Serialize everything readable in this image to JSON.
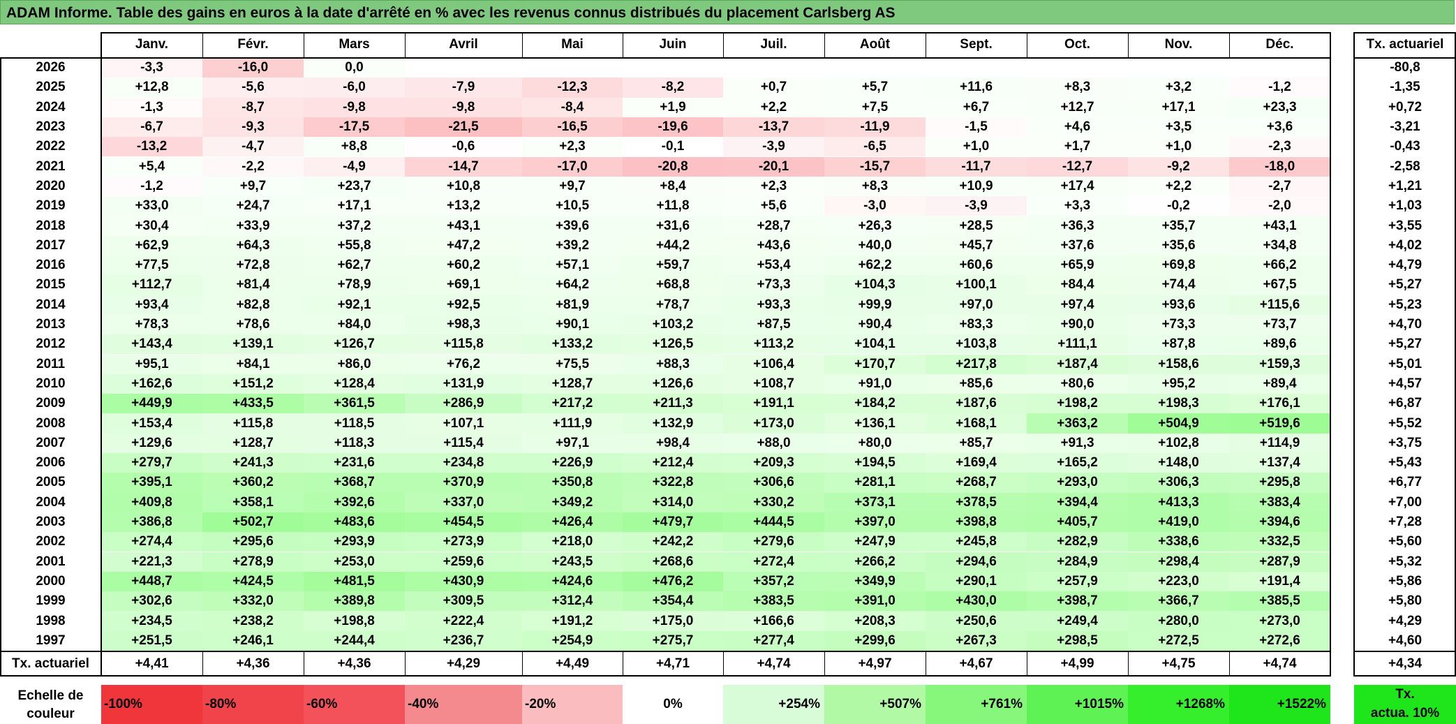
{
  "title": "ADAM Informe. Table des gains en euros à la date d'arrêté en % avec les revenus connus distribués du placement Carlsberg AS",
  "months": [
    "Janv.",
    "Févr.",
    "Mars",
    "Avril",
    "Mai",
    "Juin",
    "Juil.",
    "Août",
    "Sept.",
    "Oct.",
    "Nov.",
    "Déc."
  ],
  "tx_header": "Tx. actuariel",
  "rows": [
    {
      "year": "2026",
      "values": [
        "-3,3",
        "-16,0",
        "0,0",
        "",
        "",
        "",
        "",
        "",
        "",
        "",
        "",
        ""
      ],
      "tx": "-80,8"
    },
    {
      "year": "2025",
      "values": [
        "+12,8",
        "-5,6",
        "-6,0",
        "-7,9",
        "-12,3",
        "-8,2",
        "+0,7",
        "+5,7",
        "+11,6",
        "+8,3",
        "+3,2",
        "-1,2"
      ],
      "tx": "-1,35"
    },
    {
      "year": "2024",
      "values": [
        "-1,3",
        "-8,7",
        "-9,8",
        "-9,8",
        "-8,4",
        "+1,9",
        "+2,2",
        "+7,5",
        "+6,7",
        "+12,7",
        "+17,1",
        "+23,3"
      ],
      "tx": "+0,72"
    },
    {
      "year": "2023",
      "values": [
        "-6,7",
        "-9,3",
        "-17,5",
        "-21,5",
        "-16,5",
        "-19,6",
        "-13,7",
        "-11,9",
        "-1,5",
        "+4,6",
        "+3,5",
        "+3,6"
      ],
      "tx": "-3,21"
    },
    {
      "year": "2022",
      "values": [
        "-13,2",
        "-4,7",
        "+8,8",
        "-0,6",
        "+2,3",
        "-0,1",
        "-3,9",
        "-6,5",
        "+1,0",
        "+1,7",
        "+1,0",
        "-2,3"
      ],
      "tx": "-0,43"
    },
    {
      "year": "2021",
      "values": [
        "+5,4",
        "-2,2",
        "-4,9",
        "-14,7",
        "-17,0",
        "-20,8",
        "-20,1",
        "-15,7",
        "-11,7",
        "-12,7",
        "-9,2",
        "-18,0"
      ],
      "tx": "-2,58"
    },
    {
      "year": "2020",
      "values": [
        "-1,2",
        "+9,7",
        "+23,7",
        "+10,8",
        "+9,7",
        "+8,4",
        "+2,3",
        "+8,3",
        "+10,9",
        "+17,4",
        "+2,2",
        "-2,7"
      ],
      "tx": "+1,21"
    },
    {
      "year": "2019",
      "values": [
        "+33,0",
        "+24,7",
        "+17,1",
        "+13,2",
        "+10,5",
        "+11,8",
        "+5,6",
        "-3,0",
        "-3,9",
        "+3,3",
        "-0,2",
        "-2,0"
      ],
      "tx": "+1,03"
    },
    {
      "year": "2018",
      "values": [
        "+30,4",
        "+33,9",
        "+37,2",
        "+43,1",
        "+39,6",
        "+31,6",
        "+28,7",
        "+26,3",
        "+28,5",
        "+36,3",
        "+35,7",
        "+43,1"
      ],
      "tx": "+3,55"
    },
    {
      "year": "2017",
      "values": [
        "+62,9",
        "+64,3",
        "+55,8",
        "+47,2",
        "+39,2",
        "+44,2",
        "+43,6",
        "+40,0",
        "+45,7",
        "+37,6",
        "+35,6",
        "+34,8"
      ],
      "tx": "+4,02"
    },
    {
      "year": "2016",
      "values": [
        "+77,5",
        "+72,8",
        "+62,7",
        "+60,2",
        "+57,1",
        "+59,7",
        "+53,4",
        "+62,2",
        "+60,6",
        "+65,9",
        "+69,8",
        "+66,2"
      ],
      "tx": "+4,79"
    },
    {
      "year": "2015",
      "values": [
        "+112,7",
        "+81,4",
        "+78,9",
        "+69,1",
        "+64,2",
        "+68,8",
        "+73,3",
        "+104,3",
        "+100,1",
        "+84,4",
        "+74,4",
        "+67,5"
      ],
      "tx": "+5,27"
    },
    {
      "year": "2014",
      "values": [
        "+93,4",
        "+82,8",
        "+92,1",
        "+92,5",
        "+81,9",
        "+78,7",
        "+93,3",
        "+99,9",
        "+97,0",
        "+97,4",
        "+93,6",
        "+115,6"
      ],
      "tx": "+5,23"
    },
    {
      "year": "2013",
      "values": [
        "+78,3",
        "+78,6",
        "+84,0",
        "+98,3",
        "+90,1",
        "+103,2",
        "+87,5",
        "+90,4",
        "+83,3",
        "+90,0",
        "+73,3",
        "+73,7"
      ],
      "tx": "+4,70"
    },
    {
      "year": "2012",
      "values": [
        "+143,4",
        "+139,1",
        "+126,7",
        "+115,8",
        "+133,2",
        "+126,5",
        "+113,2",
        "+104,1",
        "+103,8",
        "+111,1",
        "+87,8",
        "+89,6"
      ],
      "tx": "+5,27"
    },
    {
      "year": "2011",
      "values": [
        "+95,1",
        "+84,1",
        "+86,0",
        "+76,2",
        "+75,5",
        "+88,3",
        "+106,4",
        "+170,7",
        "+217,8",
        "+187,4",
        "+158,6",
        "+159,3"
      ],
      "tx": "+5,01"
    },
    {
      "year": "2010",
      "values": [
        "+162,6",
        "+151,2",
        "+128,4",
        "+131,9",
        "+128,7",
        "+126,6",
        "+108,7",
        "+91,0",
        "+85,6",
        "+80,6",
        "+95,2",
        "+89,4"
      ],
      "tx": "+4,57"
    },
    {
      "year": "2009",
      "values": [
        "+449,9",
        "+433,5",
        "+361,5",
        "+286,9",
        "+217,2",
        "+211,3",
        "+191,1",
        "+184,2",
        "+187,6",
        "+198,2",
        "+198,3",
        "+176,1"
      ],
      "tx": "+6,87"
    },
    {
      "year": "2008",
      "values": [
        "+153,4",
        "+115,8",
        "+118,5",
        "+107,1",
        "+111,9",
        "+132,9",
        "+173,0",
        "+136,1",
        "+168,1",
        "+363,2",
        "+504,9",
        "+519,6"
      ],
      "tx": "+5,52"
    },
    {
      "year": "2007",
      "values": [
        "+129,6",
        "+128,7",
        "+118,3",
        "+115,4",
        "+97,1",
        "+98,4",
        "+88,0",
        "+80,0",
        "+85,7",
        "+91,3",
        "+102,8",
        "+114,9"
      ],
      "tx": "+3,75"
    },
    {
      "year": "2006",
      "values": [
        "+279,7",
        "+241,3",
        "+231,6",
        "+234,8",
        "+226,9",
        "+212,4",
        "+209,3",
        "+194,5",
        "+169,4",
        "+165,2",
        "+148,0",
        "+137,4"
      ],
      "tx": "+5,43"
    },
    {
      "year": "2005",
      "values": [
        "+395,1",
        "+360,2",
        "+368,7",
        "+370,9",
        "+350,8",
        "+322,8",
        "+306,6",
        "+281,1",
        "+268,7",
        "+293,0",
        "+306,3",
        "+295,8"
      ],
      "tx": "+6,77"
    },
    {
      "year": "2004",
      "values": [
        "+409,8",
        "+358,1",
        "+392,6",
        "+337,0",
        "+349,2",
        "+314,0",
        "+330,2",
        "+373,1",
        "+378,5",
        "+394,4",
        "+413,3",
        "+383,4"
      ],
      "tx": "+7,00"
    },
    {
      "year": "2003",
      "values": [
        "+386,8",
        "+502,7",
        "+483,6",
        "+454,5",
        "+426,4",
        "+479,7",
        "+444,5",
        "+397,0",
        "+398,8",
        "+405,7",
        "+419,0",
        "+394,6"
      ],
      "tx": "+7,28"
    },
    {
      "year": "2002",
      "values": [
        "+274,4",
        "+295,6",
        "+293,9",
        "+273,9",
        "+218,0",
        "+242,2",
        "+279,6",
        "+247,9",
        "+245,8",
        "+282,9",
        "+338,6",
        "+332,5"
      ],
      "tx": "+5,60"
    },
    {
      "year": "2001",
      "values": [
        "+221,3",
        "+278,9",
        "+253,0",
        "+259,6",
        "+243,5",
        "+268,6",
        "+272,4",
        "+266,2",
        "+294,6",
        "+284,9",
        "+298,4",
        "+287,9"
      ],
      "tx": "+5,32"
    },
    {
      "year": "2000",
      "values": [
        "+448,7",
        "+424,5",
        "+481,5",
        "+430,9",
        "+424,6",
        "+476,2",
        "+357,2",
        "+349,9",
        "+290,1",
        "+257,9",
        "+223,0",
        "+191,4"
      ],
      "tx": "+5,86"
    },
    {
      "year": "1999",
      "values": [
        "+302,6",
        "+332,0",
        "+389,8",
        "+309,5",
        "+312,4",
        "+354,4",
        "+383,5",
        "+391,0",
        "+430,0",
        "+398,7",
        "+366,7",
        "+385,5"
      ],
      "tx": "+5,80"
    },
    {
      "year": "1998",
      "values": [
        "+234,5",
        "+238,2",
        "+198,8",
        "+222,4",
        "+191,2",
        "+175,0",
        "+166,6",
        "+208,3",
        "+250,6",
        "+249,4",
        "+280,0",
        "+273,0"
      ],
      "tx": "+4,29"
    },
    {
      "year": "1997",
      "values": [
        "+251,5",
        "+246,1",
        "+244,4",
        "+236,7",
        "+254,9",
        "+275,7",
        "+277,4",
        "+299,6",
        "+267,3",
        "+298,5",
        "+272,5",
        "+272,6"
      ],
      "tx": "+4,60"
    }
  ],
  "footer": {
    "label": "Tx. actuariel",
    "values": [
      "+4,41",
      "+4,36",
      "+4,36",
      "+4,29",
      "+4,49",
      "+4,71",
      "+4,74",
      "+4,97",
      "+4,67",
      "+4,99",
      "+4,75",
      "+4,74"
    ],
    "tx": "+4,34"
  },
  "scale": {
    "label_line1": "Echelle de",
    "label_line2": "couleur",
    "items": [
      {
        "text": "-100%",
        "color": "#f0353b"
      },
      {
        "text": "-80%",
        "color": "#f1444a"
      },
      {
        "text": "-60%",
        "color": "#f3525a"
      },
      {
        "text": "-40%",
        "color": "#f58a8e"
      },
      {
        "text": "-20%",
        "color": "#fbbcbf"
      },
      {
        "text": "0%",
        "color": "#ffffff"
      },
      {
        "text": "+254%",
        "color": "#d8fcd8"
      },
      {
        "text": "+507%",
        "color": "#b2f9a6"
      },
      {
        "text": "+761%",
        "color": "#86f77a"
      },
      {
        "text": "+1015%",
        "color": "#5ef254"
      },
      {
        "text": "+1268%",
        "color": "#35ee2c"
      },
      {
        "text": "+1522%",
        "color": "#1ee61a"
      }
    ],
    "tx_line1": "Tx.",
    "tx_line2": "actua. 10%",
    "tx_color": "#1ee61a"
  }
}
